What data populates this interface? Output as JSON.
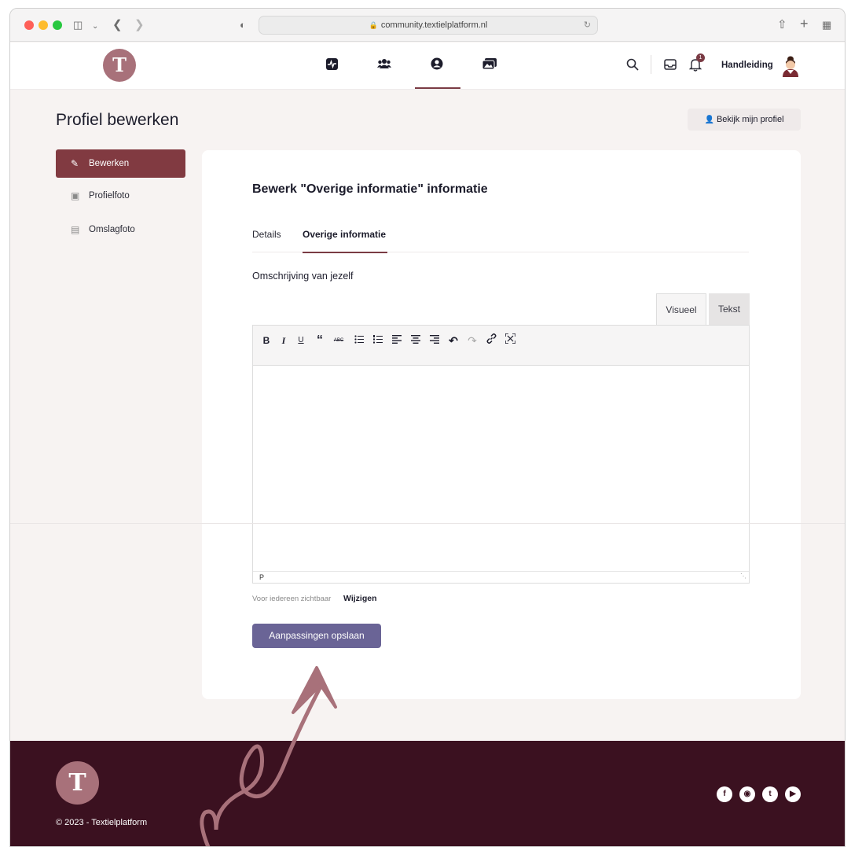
{
  "browser": {
    "url": "community.textielplatform.nl",
    "icons": [
      "sidebar-icon",
      "chevron-down-icon",
      "back-icon",
      "forward-icon",
      "shield-icon",
      "lock-icon",
      "reload-icon",
      "share-icon",
      "new-tab-icon",
      "tabs-overview-icon"
    ]
  },
  "header": {
    "logo_letter": "T",
    "nav_icons": [
      "activity-icon",
      "groups-icon",
      "profile-icon",
      "photos-icon"
    ],
    "notification_count": "1",
    "user_name": "Handleiding",
    "accent": "#7a3b44"
  },
  "page": {
    "title": "Profiel bewerken",
    "view_profile_label": "Bekijk mijn profiel"
  },
  "sidebar": {
    "items": [
      {
        "label": "Bewerken",
        "icon": "edit-icon",
        "active": true
      },
      {
        "label": "Profielfoto",
        "icon": "profile-photo-icon",
        "active": false
      },
      {
        "label": "Omslagfoto",
        "icon": "cover-photo-icon",
        "active": false
      }
    ]
  },
  "form": {
    "title": "Bewerk \"Overige informatie\" informatie",
    "tabs": [
      {
        "label": "Details",
        "active": false
      },
      {
        "label": "Overige informatie",
        "active": true
      }
    ],
    "field_label": "Omschrijving van jezelf",
    "editor_tabs": {
      "visual": "Visueel",
      "text": "Tekst"
    },
    "toolbar": [
      "B",
      "I",
      "U",
      "“",
      "ABC",
      "•",
      "1.",
      "≡",
      "≡",
      "≡",
      "↶",
      "↷",
      "🔗",
      "⤢"
    ],
    "status_path": "P",
    "visibility_text": "Voor iedereen zichtbaar",
    "visibility_change": "Wijzigen",
    "save_label": "Aanpassingen opslaan",
    "save_color": "#6a6496"
  },
  "footer": {
    "logo_letter": "T",
    "copyright": "© 2023 - Textielplatform",
    "social": [
      "facebook-icon",
      "instagram-icon",
      "twitter-icon",
      "youtube-icon"
    ],
    "background": "#3b1120"
  }
}
